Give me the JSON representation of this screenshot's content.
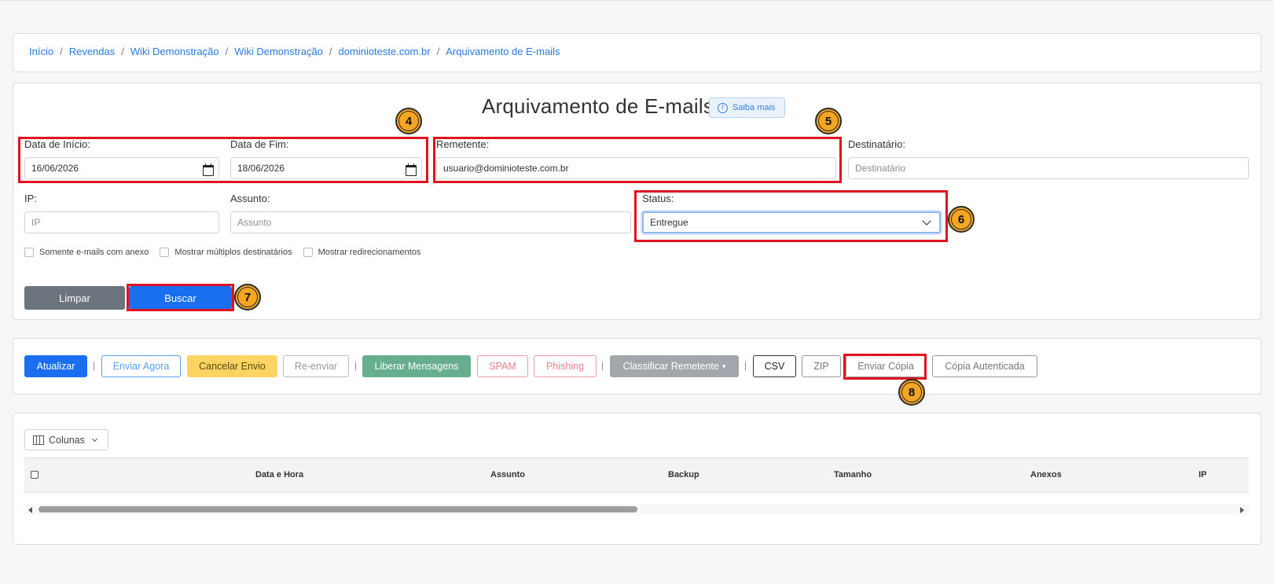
{
  "breadcrumb": [
    {
      "label": "Início"
    },
    {
      "label": "Revendas"
    },
    {
      "label": "Wiki Demonstração"
    },
    {
      "label": "Wiki Demonstração"
    },
    {
      "label": "dominioteste.com.br"
    },
    {
      "label": "Arquivamento de E-mails"
    }
  ],
  "page": {
    "title": "Arquivamento de E-mails",
    "help_label": "Saiba mais"
  },
  "filters": {
    "start_date": {
      "label": "Data de Início:",
      "value": "16/06/2026"
    },
    "end_date": {
      "label": "Data de Fim:",
      "value": "18/06/2026"
    },
    "sender": {
      "label": "Remetente:",
      "value": "usuario@dominioteste.com.br"
    },
    "recipient": {
      "label": "Destinatário:",
      "placeholder": "Destinatário"
    },
    "ip": {
      "label": "IP:",
      "placeholder": "IP"
    },
    "subject": {
      "label": "Assunto:",
      "placeholder": "Assunto"
    },
    "status": {
      "label": "Status:",
      "value": "Entregue"
    },
    "checkboxes": [
      "Somente e-mails com anexo",
      "Mostrar múltiplos destinatários",
      "Mostrar redirecionamentos"
    ],
    "clear_label": "Limpar",
    "search_label": "Buscar"
  },
  "toolbar": {
    "refresh": "Atualizar",
    "send_now": "Enviar Agora",
    "cancel_send": "Cancelar Envio",
    "resend": "Re-enviar",
    "release": "Liberar Mensagens",
    "spam": "SPAM",
    "phishing": "Phishing",
    "classify": "Classificar Remetente",
    "csv": "CSV",
    "zip": "ZIP",
    "send_copy": "Enviar Cópia",
    "auth_copy": "Cópia Autenticada"
  },
  "table": {
    "columns_button": "Colunas",
    "headers": [
      "Data e Hora",
      "Assunto",
      "Backup",
      "Tamanho",
      "Anexos",
      "IP"
    ]
  },
  "annotations": [
    "4",
    "5",
    "6",
    "7",
    "8"
  ],
  "colors": {
    "highlight": "#e0141e",
    "badge": "#f6a623",
    "primary": "#1a6ff0"
  }
}
